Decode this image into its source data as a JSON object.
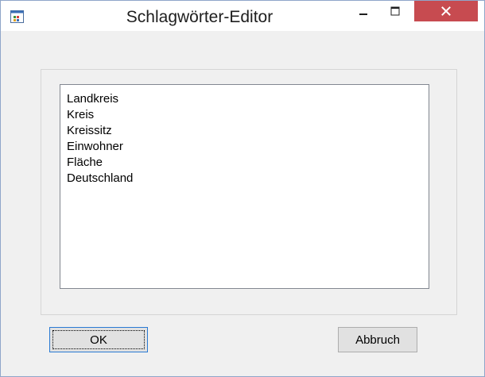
{
  "window": {
    "title": "Schlagwörter-Editor",
    "controls": {
      "minimize_icon": "minimize-icon",
      "maximize_icon": "maximize-icon",
      "close_icon": "close-icon",
      "close_color": "#c74b50"
    }
  },
  "keywords": {
    "items": [
      "Landkreis",
      "Kreis",
      "Kreissitz",
      "Einwohner",
      "Fläche",
      "Deutschland"
    ]
  },
  "buttons": {
    "ok_label": "OK",
    "cancel_label": "Abbruch"
  },
  "colors": {
    "focus_border": "#2a7ad3",
    "window_bg": "#f0f0f0"
  }
}
